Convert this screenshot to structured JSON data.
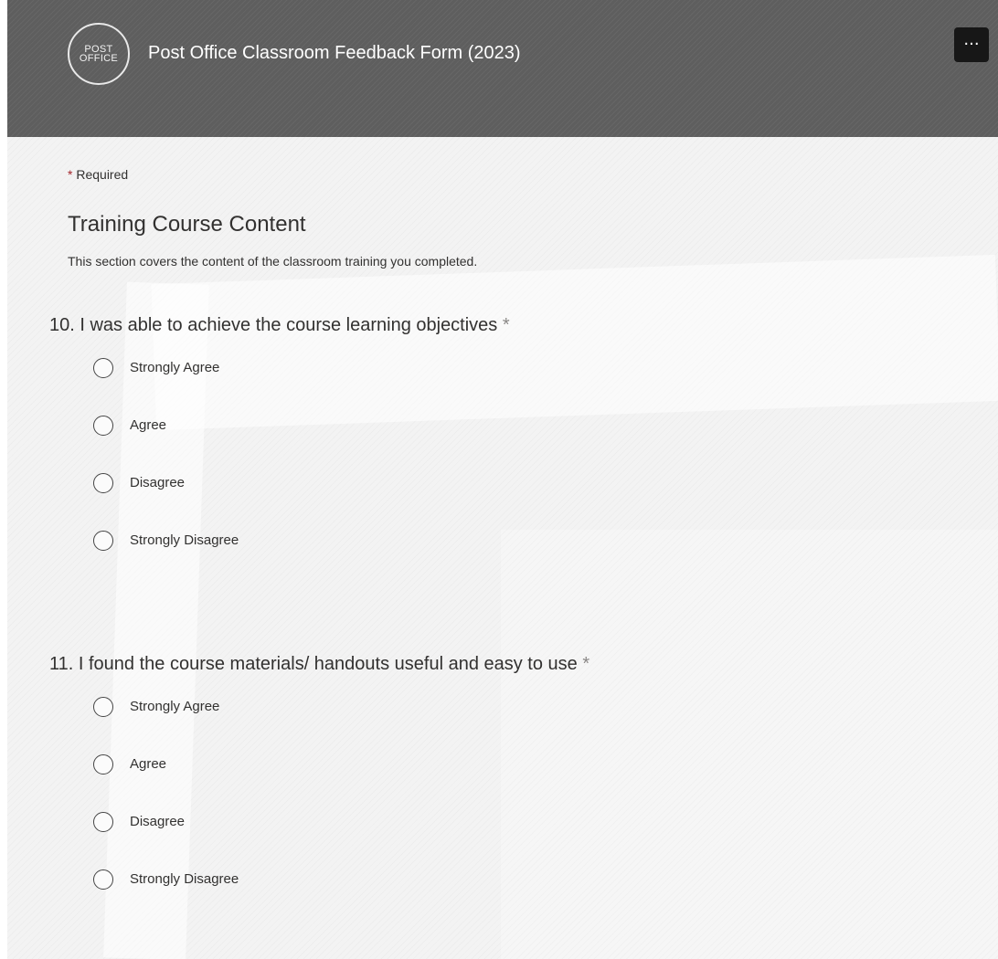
{
  "header": {
    "logo": {
      "line1": "POST",
      "line2": "OFFICE"
    },
    "title": "Post Office Classroom Feedback Form (2023)",
    "more_label": "···"
  },
  "form": {
    "required_star": "*",
    "required_text": "Required",
    "section_title": "Training Course Content",
    "section_description": "This section covers the content of the classroom training you completed."
  },
  "questions": [
    {
      "number": "10.",
      "text": "I was able to achieve the course learning objectives",
      "required_star": "*",
      "options": [
        "Strongly Agree",
        "Agree",
        "Disagree",
        "Strongly Disagree"
      ]
    },
    {
      "number": "11.",
      "text": "I found the course materials/ handouts useful and easy to use",
      "required_star": "*",
      "options": [
        "Strongly Agree",
        "Agree",
        "Disagree",
        "Strongly Disagree"
      ]
    }
  ]
}
